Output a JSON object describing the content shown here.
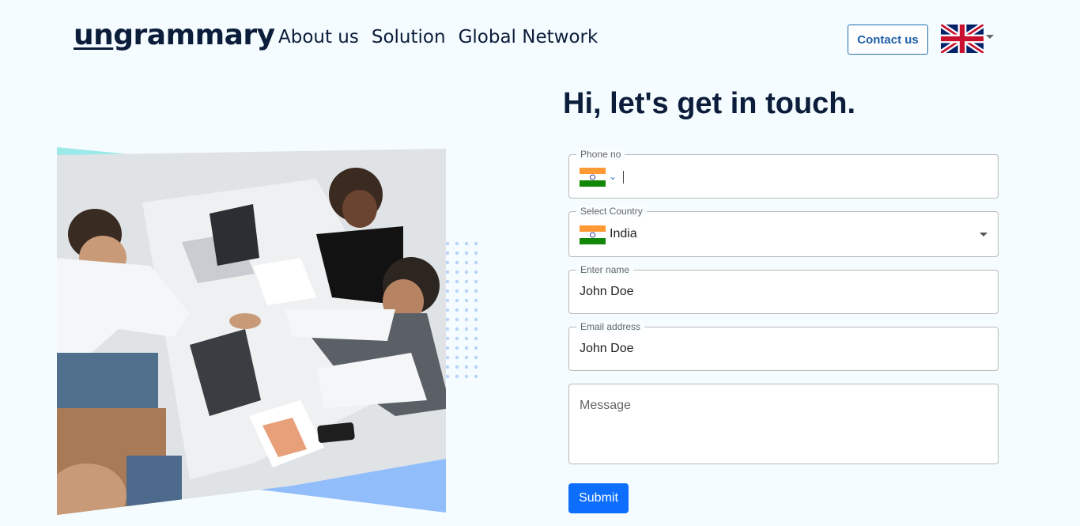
{
  "brand": {
    "logo_prefix": "un",
    "logo_suffix": "grammary"
  },
  "nav": {
    "items": [
      "About us",
      "Solution",
      "Global Network"
    ]
  },
  "header": {
    "contact_label": "Contact us",
    "language_icon": "uk-flag-icon"
  },
  "form": {
    "title": "Hi, let's get in touch.",
    "phone": {
      "label": "Phone no",
      "flag_icon": "india-flag-icon"
    },
    "country": {
      "label": "Select Country",
      "value": "India",
      "flag_icon": "india-flag-icon"
    },
    "name": {
      "label": "Enter name",
      "value": "John Doe"
    },
    "email": {
      "label": "Email address",
      "value": "John Doe"
    },
    "message": {
      "placeholder": "Message"
    },
    "submit_label": "Submit"
  },
  "colors": {
    "accent": "#0d6efd",
    "text": "#0b1d3a",
    "background": "#f5fcff",
    "teal_shape": "#9ce9ea",
    "blue_shape": "#92bdfb"
  }
}
